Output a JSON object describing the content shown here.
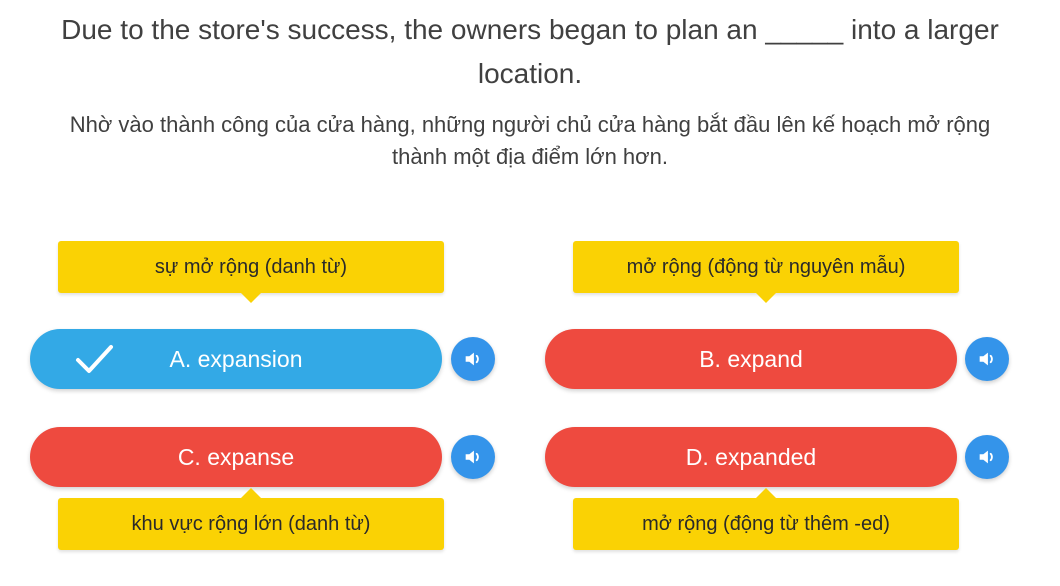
{
  "question": {
    "text": "Due to the store's success, the owners began to plan an _____ into a larger location.",
    "translation": "Nhờ vào thành công của cửa hàng, những người chủ cửa hàng bắt đầu lên kế hoạch mở rộng thành một địa điểm lớn hơn."
  },
  "options": [
    {
      "label": "A. expansion",
      "hint": "sự mở rộng (danh từ)",
      "status": "correct",
      "selected": true
    },
    {
      "label": "B. expand",
      "hint": "mở rộng (động từ nguyên mẫu)",
      "status": "wrong",
      "selected": false
    },
    {
      "label": "C. expanse",
      "hint": "khu vực rộng lớn (danh từ)",
      "status": "wrong",
      "selected": false
    },
    {
      "label": "D. expanded",
      "hint": "mở rộng (động từ thêm -ed)",
      "status": "wrong",
      "selected": false
    }
  ],
  "colors": {
    "correct": "#33a9e6",
    "wrong": "#ee4a3f",
    "hint_bg": "#fad204",
    "audio_button": "#3494ea"
  },
  "icons": {
    "check": "checkmark-icon",
    "audio": "speaker-icon"
  }
}
